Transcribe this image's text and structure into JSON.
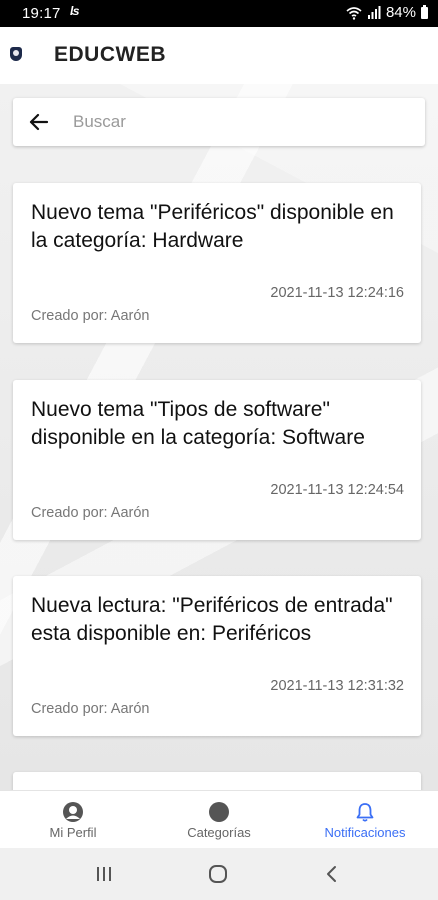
{
  "status_bar": {
    "time": "19:17",
    "notification": "ʪ",
    "battery": "84%"
  },
  "app": {
    "title": "EDUCWEB"
  },
  "search": {
    "placeholder": "Buscar",
    "value": ""
  },
  "notifications": [
    {
      "title": "Nuevo tema \"Periféricos\" disponible en la categoría: Hardware",
      "date": "2021-11-13 12:24:16",
      "author": "Creado por: Aarón"
    },
    {
      "title": "Nuevo tema \"Tipos de software\" disponible en la categoría: Software",
      "date": "2021-11-13 12:24:54",
      "author": "Creado por: Aarón"
    },
    {
      "title": "Nueva lectura: \"Periféricos de entrada\" esta disponible en: Periféricos",
      "date": "2021-11-13 12:31:32",
      "author": "Creado por: Aarón"
    }
  ],
  "bottom_nav": {
    "items": [
      {
        "label": "Mi Perfil",
        "icon": "profile-icon",
        "active": false
      },
      {
        "label": "Categorías",
        "icon": "circle-icon",
        "active": false
      },
      {
        "label": "Notificaciones",
        "icon": "bell-icon",
        "active": true
      }
    ]
  },
  "colors": {
    "accent": "#3b6ff5",
    "nav_inactive": "#666666"
  }
}
